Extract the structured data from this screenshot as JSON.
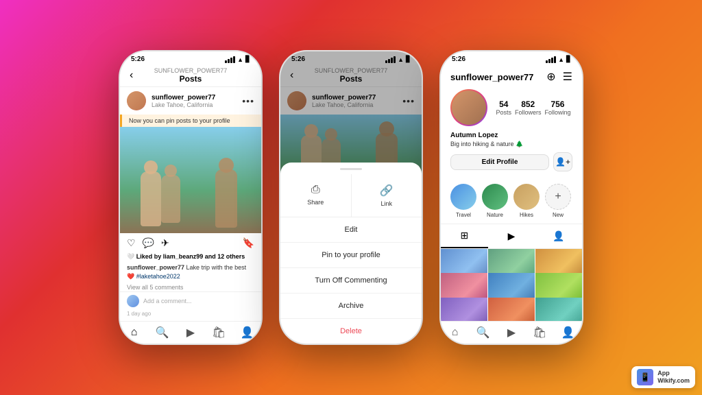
{
  "background": "linear-gradient(135deg, #f02fc2 0%, #e03030 30%, #f07020 60%, #f0a020 100%)",
  "phone1": {
    "statusBar": {
      "time": "5:26"
    },
    "navUsername": "SUNFLOWER_POWER77",
    "navTitle": "Posts",
    "postUsername": "sunflower_power77",
    "postLocation": "Lake Tahoe, California",
    "pinBanner": "Now you can pin posts to your profile",
    "likesText": "🤍 Liked by liam_beanz99 and 12 others",
    "captionUser": "sunflower_power77",
    "captionText": "Lake trip with the best ❤️",
    "hashtag": "#laketahoe2022",
    "viewComments": "View all 5 comments",
    "addCommentPlaceholder": "Add a comment...",
    "timestamp": "1 day ago"
  },
  "phone2": {
    "statusBar": {
      "time": "5:26"
    },
    "navUsername": "SUNFLOWER_POWER77",
    "navTitle": "Posts",
    "postUsername": "sunflower_power77",
    "postLocation": "Lake Tahoe, California",
    "shareLabel": "Share",
    "linkLabel": "Link",
    "editLabel": "Edit",
    "pinLabel": "Pin to your profile",
    "turnOffCommentingLabel": "Turn Off Commenting",
    "archiveLabel": "Archive",
    "deleteLabel": "Delete"
  },
  "phone3": {
    "statusBar": {
      "time": "5:26"
    },
    "username": "sunflower_power77",
    "posts": "54",
    "postsLabel": "Posts",
    "followers": "852",
    "followersLabel": "Followers",
    "following": "756",
    "followingLabel": "Following",
    "bioName": "Autumn Lopez",
    "bioText": "Big into hiking & nature 🌲",
    "editProfileLabel": "Edit Profile",
    "highlights": [
      {
        "label": "Travel"
      },
      {
        "label": "Nature"
      },
      {
        "label": "Hikes"
      },
      {
        "label": "New"
      }
    ]
  },
  "watermark": {
    "line1": "App",
    "line2": "Wikify.com"
  }
}
